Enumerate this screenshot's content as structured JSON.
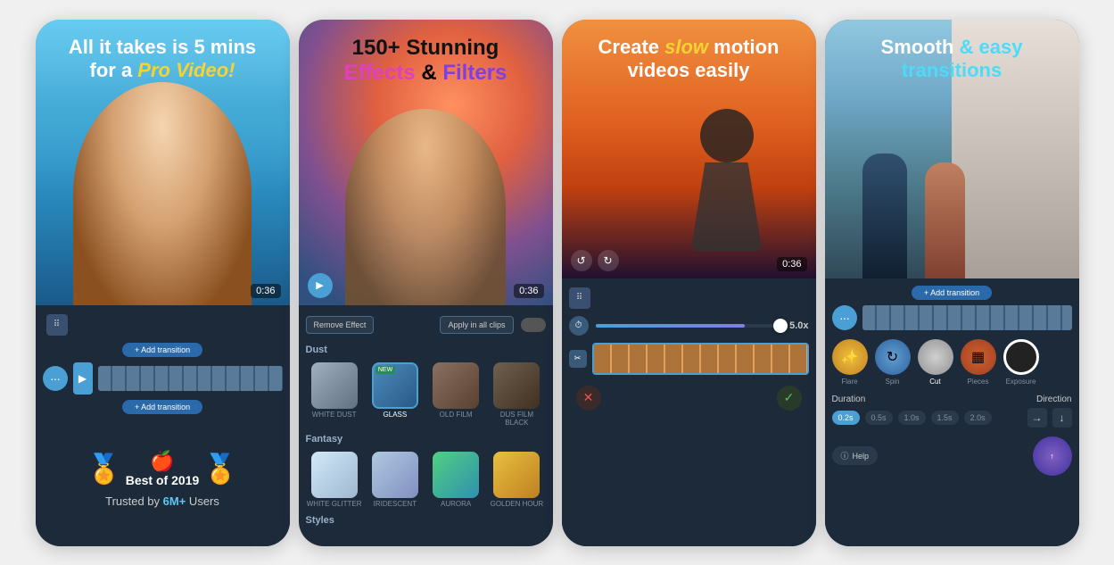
{
  "cards": [
    {
      "id": "card1",
      "headline_line1": "All it takes is 5 mins",
      "headline_line2_prefix": "for a ",
      "headline_line2_highlight": "Pro Video!",
      "timer": "0:36",
      "add_transition_1": "+ Add transition",
      "add_transition_2": "+ Add transition",
      "award_year": "Best of 2019",
      "trusted_prefix": "Trusted by ",
      "trusted_highlight": "6M+",
      "trusted_suffix": " Users"
    },
    {
      "id": "card2",
      "headline_line1": "150+ Stunning",
      "headline_effects": "Effects",
      "headline_and": " & ",
      "headline_filters": "Filters",
      "timer": "0:36",
      "remove_effect": "Remove Effect",
      "apply_all": "Apply in all clips",
      "category1": "Dust",
      "effects_dust": [
        "WHITE DUST",
        "GLASS",
        "OLD FILM",
        "DUS FILM BLACK"
      ],
      "category2": "Fantasy",
      "effects_fantasy": [
        "WHITE GLITTER",
        "IRIDESCENT",
        "AURORA",
        "GOLDEN HOUR"
      ],
      "category3": "Styles"
    },
    {
      "id": "card3",
      "headline_line1": "Create ",
      "headline_slow": "slow",
      "headline_line1_suffix": " motion",
      "headline_line2": "videos easily",
      "timer": "0:36",
      "speed_value": "5.0x"
    },
    {
      "id": "card4",
      "headline_smooth": "Smooth",
      "headline_and": " & easy",
      "headline_transitions": "transitions",
      "transitions": [
        {
          "label": "Flare"
        },
        {
          "label": "Spin"
        },
        {
          "label": "Cut"
        },
        {
          "label": "Pieces"
        },
        {
          "label": "Exposure"
        }
      ],
      "duration_label": "Duration",
      "direction_label": "Direction",
      "durations": [
        "0.2s",
        "0.5s",
        "1.0s",
        "1.5s",
        "2.0s"
      ],
      "selected_duration": "0.2s",
      "help_label": "Help",
      "add_transition": "+ Add transition"
    }
  ]
}
